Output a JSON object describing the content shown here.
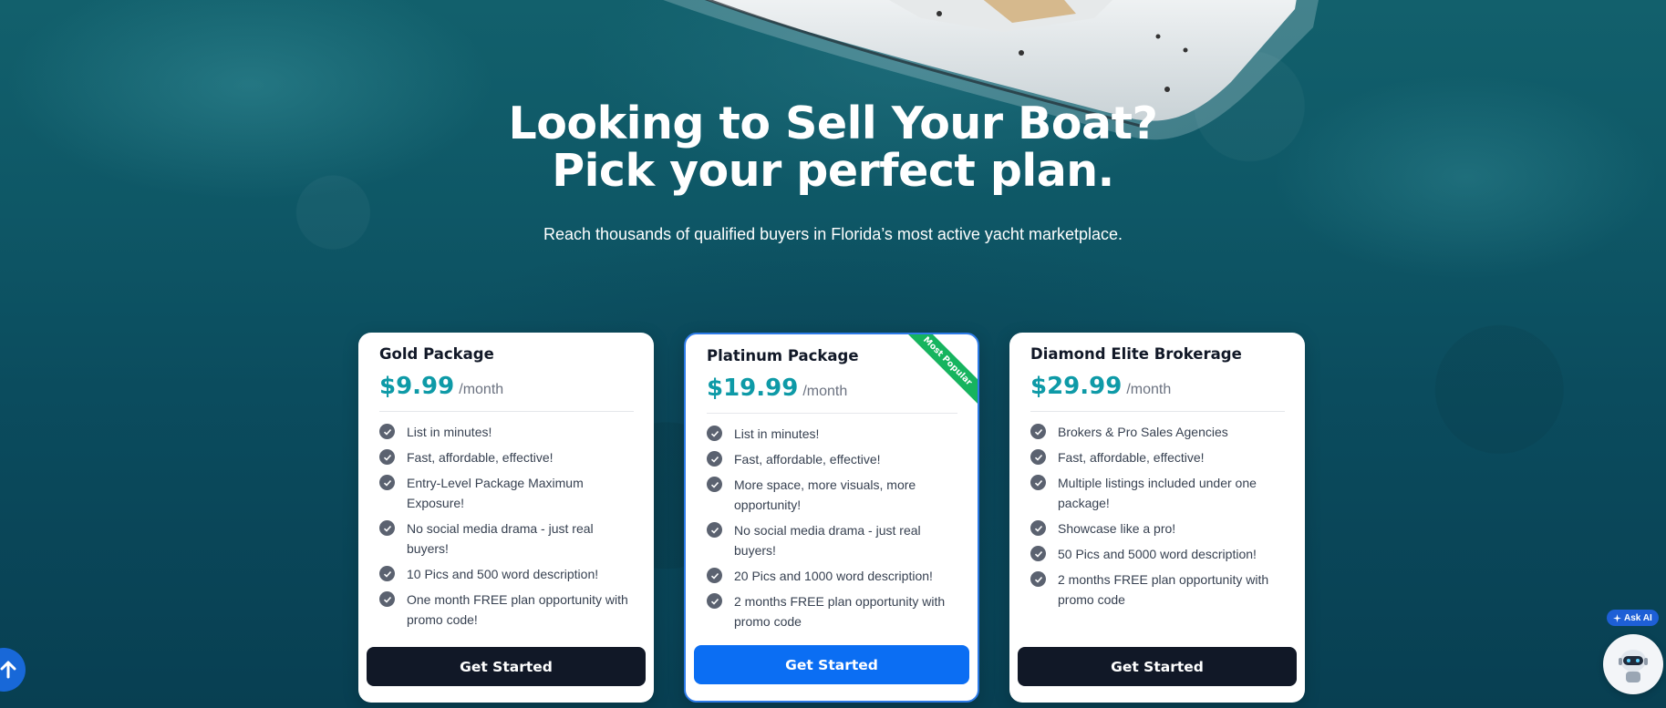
{
  "hero": {
    "title_line1": "Looking to Sell Your Boat?",
    "title_line2": "Pick your perfect plan.",
    "subtitle": "Reach thousands of qualified buyers in Florida’s most active yacht marketplace."
  },
  "plans": [
    {
      "name": "Gold Package",
      "price": "$9.99",
      "period": "/month",
      "features": [
        "List in minutes!",
        "Fast, affordable, effective!",
        "Entry-Level Package Maximum Exposure!",
        "No social media drama - just real buyers!",
        "10 Pics and 500 word description!",
        "One month FREE plan opportunity with promo code!"
      ],
      "cta": "Get Started"
    },
    {
      "name": "Platinum Package",
      "price": "$19.99",
      "period": "/month",
      "badge": "Most Popular",
      "features": [
        "List in minutes!",
        "Fast, affordable, effective!",
        "More space, more visuals, more opportunity!",
        "No social media drama - just real buyers!",
        "20 Pics and 1000 word description!",
        "2 months FREE plan opportunity with promo code"
      ],
      "cta": "Get Started"
    },
    {
      "name": "Diamond Elite Brokerage",
      "price": "$29.99",
      "period": "/month",
      "features": [
        "Brokers & Pro Sales Agencies",
        "Fast, affordable, effective!",
        "Multiple listings included under one package!",
        "Showcase like a pro!",
        "50 Pics and 5000 word description!",
        "2 months FREE plan opportunity with promo code"
      ],
      "cta": "Get Started"
    }
  ],
  "widgets": {
    "ask_ai_label": "Ask AI",
    "scroll_top_icon": "arrow-up-icon",
    "chatbot_icon": "robot-icon"
  },
  "colors": {
    "price": "#0e9aa7",
    "primary_button": "#0b6ef3",
    "dark_button": "#111827",
    "badge": "#16b45f",
    "featured_border": "#2d7be8"
  }
}
